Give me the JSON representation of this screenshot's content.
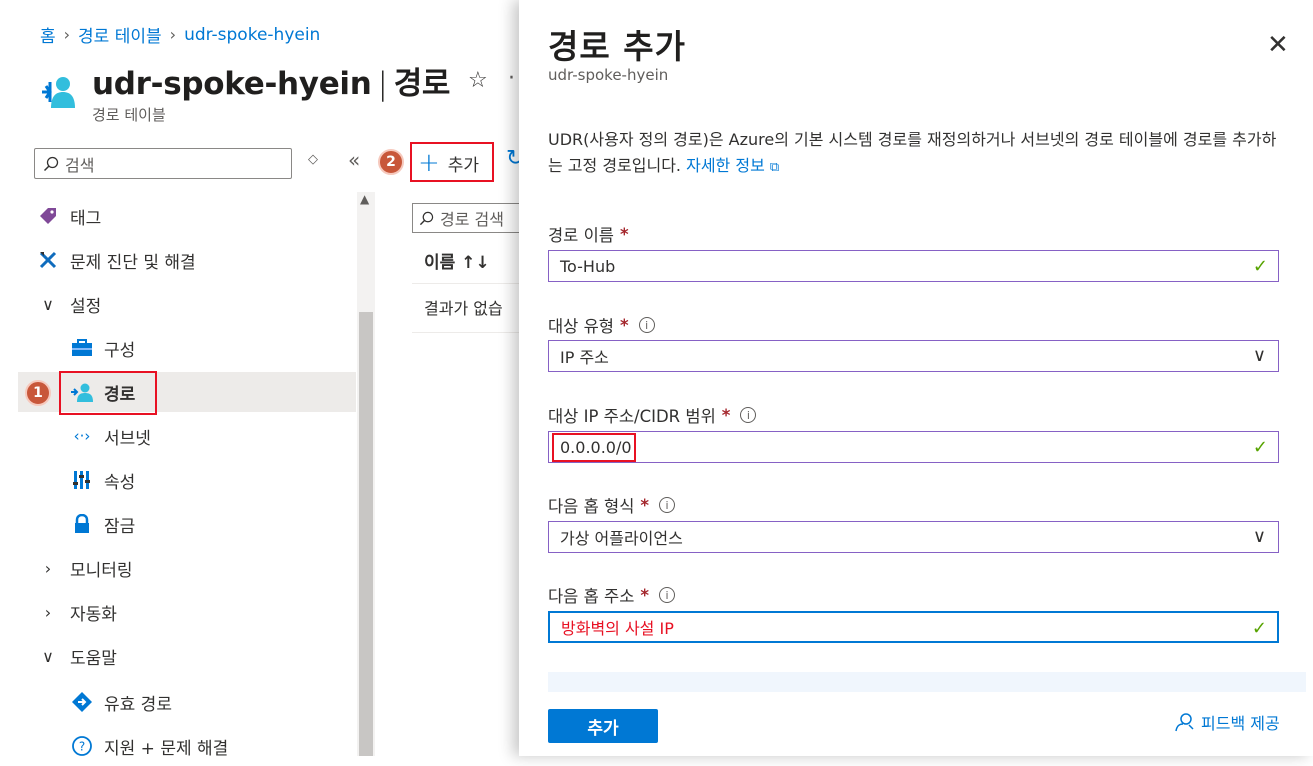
{
  "breadcrumb": {
    "home": "홈",
    "route_tables": "경로 테이블",
    "current": "udr-spoke-hyein"
  },
  "header": {
    "name": "udr-spoke-hyein",
    "section": "경로",
    "subtitle": "경로 테이블"
  },
  "sidebar": {
    "search_placeholder": "검색",
    "items": [
      {
        "label": "태그",
        "icon": "tag-icon"
      },
      {
        "label": "문제 진단 및 해결",
        "icon": "wrench-icon"
      },
      {
        "label": "설정",
        "icon": "chevron-down-icon"
      },
      {
        "label": "구성",
        "icon": "toolbox-icon"
      },
      {
        "label": "경로",
        "icon": "route-icon"
      },
      {
        "label": "서브넷",
        "icon": "subnet-icon"
      },
      {
        "label": "속성",
        "icon": "properties-icon"
      },
      {
        "label": "잠금",
        "icon": "lock-icon"
      },
      {
        "label": "모니터링",
        "icon": "chevron-right-icon"
      },
      {
        "label": "자동화",
        "icon": "chevron-right-icon"
      },
      {
        "label": "도움말",
        "icon": "chevron-down-icon"
      },
      {
        "label": "유효 경로",
        "icon": "effective-routes-icon"
      },
      {
        "label": "지원 + 문제 해결",
        "icon": "help-icon"
      }
    ]
  },
  "toolbar": {
    "add_label": "추가"
  },
  "list": {
    "search_placeholder": "경로 검색",
    "column_name": "이름 ↑↓",
    "empty": "결과가 없습"
  },
  "badges": {
    "one": "1",
    "two": "2"
  },
  "panel": {
    "title": "경로 추가",
    "subtitle": "udr-spoke-hyein",
    "description": "UDR(사용자 정의 경로)은 Azure의 기본 시스템 경로를 재정의하거나 서브넷의 경로 테이블에 경로를 추가하는 고정 경로입니다. ",
    "learn_more": "자세한 정보",
    "fields": {
      "route_name_label": "경로 이름",
      "route_name_value": "To-Hub",
      "dest_type_label": "대상 유형",
      "dest_type_value": "IP 주소",
      "dest_ip_label": "대상 IP 주소/CIDR 범위",
      "dest_ip_value": "0.0.0.0/0",
      "next_hop_type_label": "다음 홉 형식",
      "next_hop_type_value": "가상 어플라이언스",
      "next_hop_addr_label": "다음 홉 주소",
      "next_hop_addr_value": "방화벽의 사설 IP"
    },
    "submit_label": "추가",
    "feedback_label": "피드백 제공"
  },
  "colors": {
    "accent": "#0078d4",
    "highlight_red": "#e81123",
    "valid_green": "#57a300",
    "badge": "#c8573a"
  }
}
